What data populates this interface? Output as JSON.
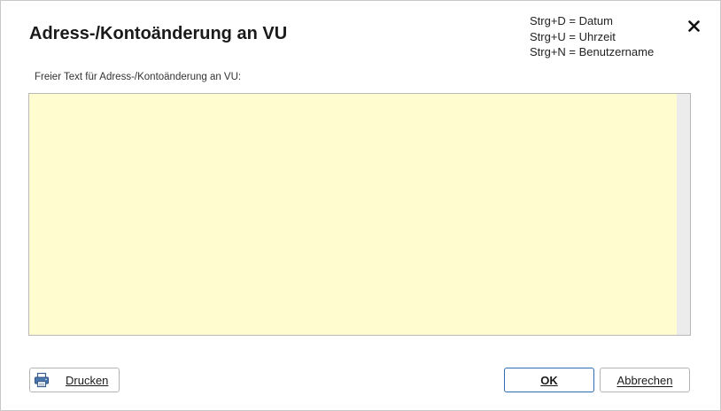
{
  "dialog": {
    "title": "Adress-/Kontoänderung an VU",
    "shortcuts": [
      "Strg+D = Datum",
      "Strg+U = Uhrzeit",
      "Strg+N = Benutzername"
    ],
    "close_icon": "close-icon"
  },
  "form": {
    "label": "Freier Text für Adress-/Kontoänderung an VU:",
    "value": "",
    "background_color": "#fffdd0"
  },
  "buttons": {
    "print_label": "Drucken",
    "print_icon": "printer-icon",
    "ok_label": "OK",
    "cancel_label": "Abbrechen",
    "accent_color": "#2f6bb3"
  }
}
